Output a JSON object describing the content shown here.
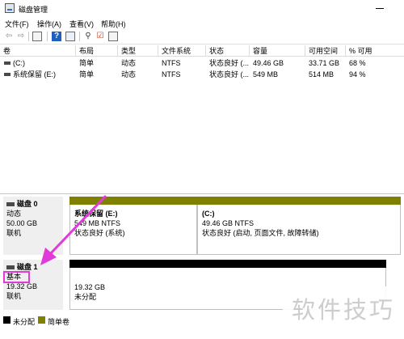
{
  "window": {
    "title": "磁盘管理"
  },
  "menubar": {
    "items": [
      "文件(F)",
      "操作(A)",
      "查看(V)",
      "帮助(H)"
    ]
  },
  "toolbar": {
    "icons": [
      "back-arrow-icon",
      "forward-arrow-icon",
      "console-tree-icon",
      "help-icon",
      "properties-icon",
      "key-icon",
      "checklist-icon",
      "view-icon"
    ]
  },
  "volume_table": {
    "headers": [
      "卷",
      "布局",
      "类型",
      "文件系统",
      "状态",
      "容量",
      "可用空间",
      "% 可用"
    ],
    "rows": [
      {
        "vol": "(C:)",
        "layout": "简单",
        "type": "动态",
        "fs": "NTFS",
        "status": "状态良好 (...",
        "capacity": "49.46 GB",
        "free": "33.71 GB",
        "pct": "68 %"
      },
      {
        "vol": "系统保留 (E:)",
        "layout": "简单",
        "type": "动态",
        "fs": "NTFS",
        "status": "状态良好 (...",
        "capacity": "549 MB",
        "free": "514 MB",
        "pct": "94 %"
      }
    ]
  },
  "disks": [
    {
      "name": "磁盘 0",
      "type": "动态",
      "size": "50.00 GB",
      "status": "联机",
      "partitions": [
        {
          "name": "系统保留 (E:)",
          "detail": "549 MB NTFS",
          "status": "状态良好 (系统)",
          "bar_color": "#808000"
        },
        {
          "name": "(C:)",
          "detail": "49.46 GB NTFS",
          "status": "状态良好 (启动, 页面文件, 故障转储)",
          "bar_color": "#808000"
        }
      ]
    },
    {
      "name": "磁盘 1",
      "type": "基本",
      "size": "19.32 GB",
      "status": "联机",
      "partitions": [
        {
          "name": "",
          "detail": "19.32 GB",
          "status": "未分配",
          "bar_color": "#000000"
        }
      ]
    }
  ],
  "legend": [
    {
      "label": "未分配",
      "color": "#000000"
    },
    {
      "label": "简单卷",
      "color": "#808000"
    }
  ],
  "annotation": {
    "color": "#e23ad9"
  },
  "watermark": "软件技巧"
}
